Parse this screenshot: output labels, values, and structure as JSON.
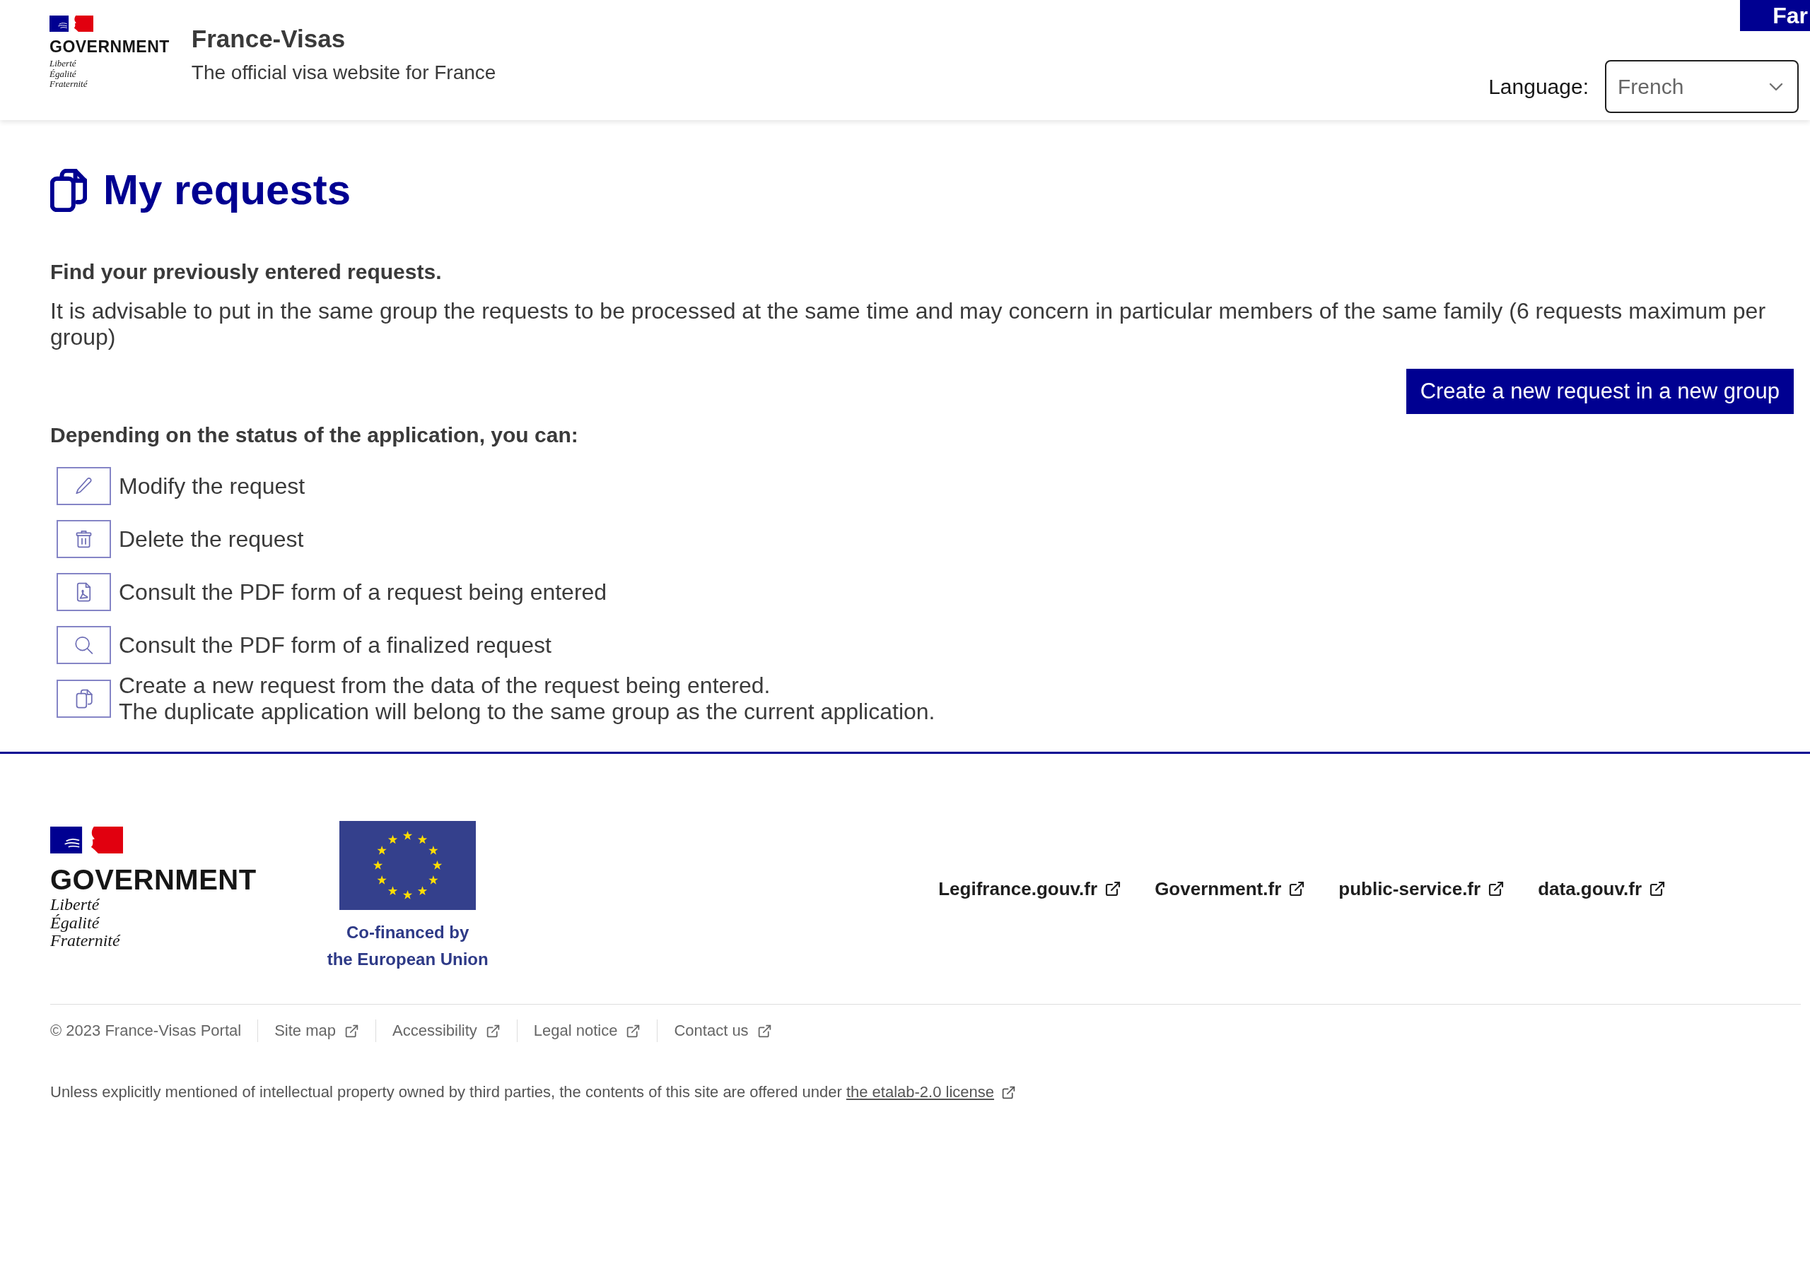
{
  "header": {
    "logo": {
      "name": "GOVERNMENT",
      "motto": [
        "Liberté",
        "Égalité",
        "Fraternité"
      ]
    },
    "site_name": "France-Visas",
    "tagline": "The official visa website for France",
    "corner_link": "Far",
    "language": {
      "label": "Language:",
      "value": "French"
    }
  },
  "main": {
    "title": "My requests",
    "intro_heading": "Find your previously entered requests.",
    "intro_text": "It is advisable to put in the same group the requests to be processed at the same time and may concern in particular members of the same family (6 requests maximum per group)",
    "create_button": "Create a new request in a new group",
    "actions_heading": "Depending on the status of the application, you can:",
    "actions": [
      {
        "kind": "edit",
        "lines": [
          "Modify the request"
        ]
      },
      {
        "kind": "delete",
        "lines": [
          "Delete the request"
        ]
      },
      {
        "kind": "pdf",
        "lines": [
          "Consult the PDF form of a request being entered"
        ]
      },
      {
        "kind": "search",
        "lines": [
          "Consult the PDF form of a finalized request"
        ]
      },
      {
        "kind": "duplicate",
        "lines": [
          "Create a new request from the data of the request being entered.",
          "The duplicate application will belong to the same group as the current application."
        ]
      }
    ]
  },
  "footer": {
    "logo": {
      "name": "GOVERNMENT",
      "motto": [
        "Liberté",
        "Égalité",
        "Fraternité"
      ]
    },
    "eu_caption": [
      "Co-financed by",
      "the European Union"
    ],
    "partner_links": [
      "Legifrance.gouv.fr",
      "Government.fr",
      "public-service.fr",
      "data.gouv.fr"
    ],
    "copyright": "© 2023 France-Visas Portal",
    "links": [
      "Site map",
      "Accessibility",
      "Legal notice",
      "Contact us"
    ],
    "license": {
      "text": "Unless explicitly mentioned of intellectual property owned by third parties, the contents of this site are offered under",
      "link": "the etalab-2.0 license"
    }
  }
}
